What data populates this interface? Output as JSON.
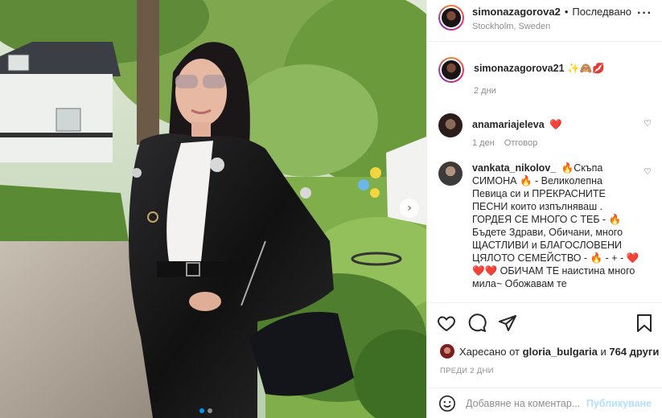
{
  "post": {
    "username": "simonazagorova2",
    "follow_label": "Последвано",
    "location": "Stockholm, Sweden"
  },
  "caption": {
    "username": "simonazagorova21",
    "emojis": "✨🙈💋",
    "time": "2 дни"
  },
  "comments": [
    {
      "username": "anamariajeleva",
      "text": "❤️",
      "time": "1 ден",
      "reply_label": "Отговор"
    },
    {
      "username": "vankata_nikolov_",
      "text": "🔥Скъпа СИМОНА 🔥 - Великолепна Певица си и ПРЕКРАСНИТЕ ПЕСНИ които изпълняваш . ГОРДЕЯ СЕ МНОГО С ТЕБ - 🔥 Бъдете Здрави, Обичани, много ЩАСТЛИВИ и БЛАГОСЛОВЕНИ ЦЯЛОТО СЕМЕЙСТВО - 🔥 - + - ❤️❤️❤️ ОБИЧАМ ТЕ наистина много мила~ Обожавам те"
    }
  ],
  "likes": {
    "prefix": "Харесано от",
    "user": "gloria_bulgaria",
    "joiner": "и",
    "count_text": "764 други"
  },
  "date_label": "ПРЕДИ 2 ДНИ",
  "add_comment": {
    "placeholder": "Добавяне на коментар...",
    "publish_label": "Публикуване"
  },
  "icons": {
    "more": "more-dots-icon",
    "like": "heart-icon",
    "comment": "comment-bubble-icon",
    "share": "paper-plane-icon",
    "save": "bookmark-icon",
    "emoji": "smiley-icon",
    "next": "chevron-right-icon"
  },
  "colors": {
    "accent": "#0095f6",
    "publish_disabled": "#b2dffc",
    "heart": "#e0245e"
  }
}
